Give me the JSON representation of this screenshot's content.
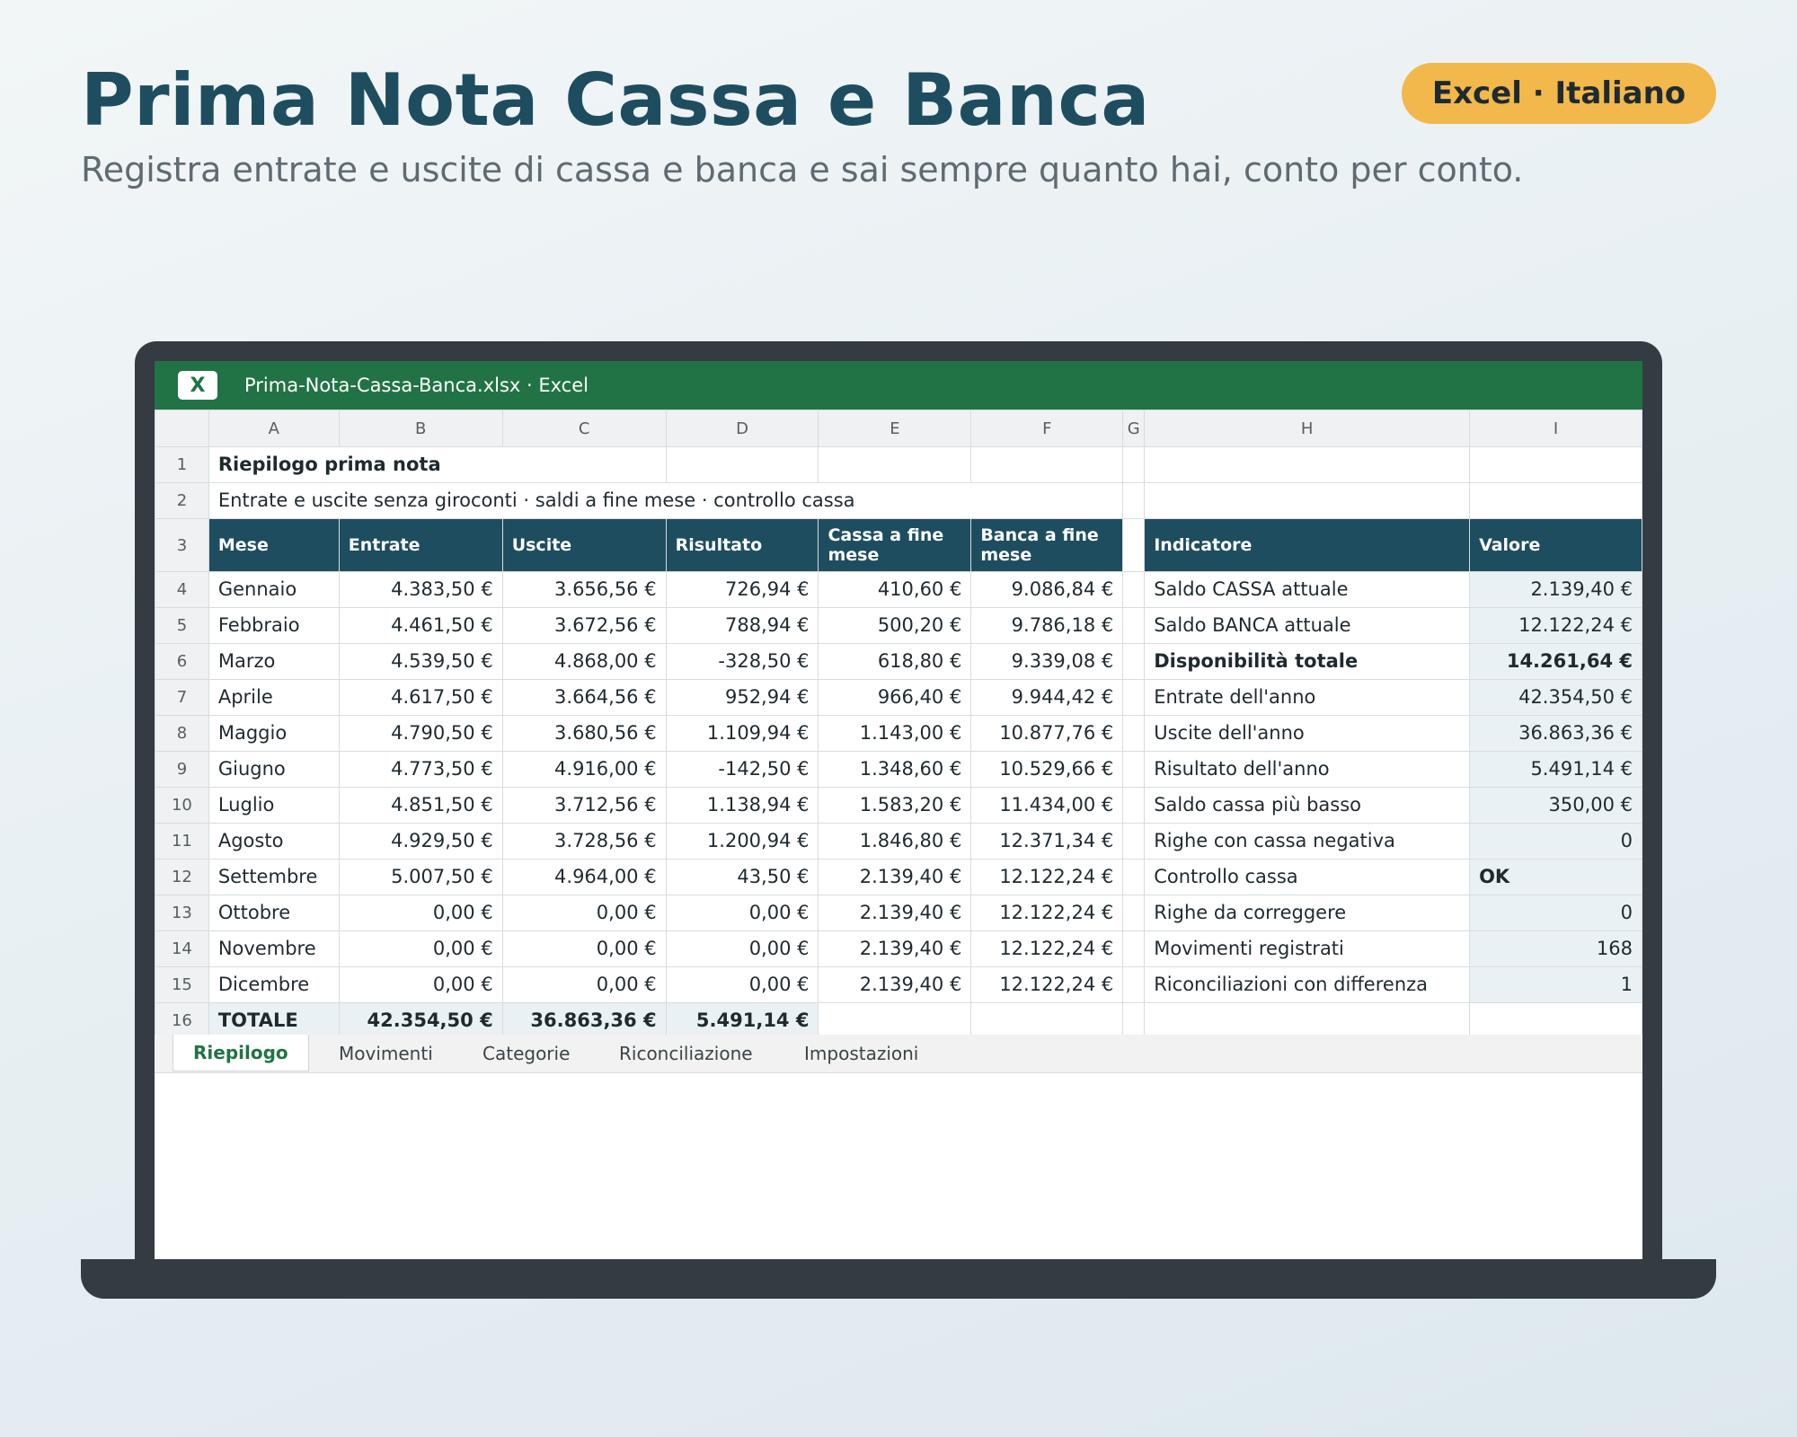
{
  "page": {
    "title": "Prima Nota Cassa e Banca",
    "subtitle": "Registra entrate e uscite di cassa e banca e sai sempre quanto hai, conto per conto.",
    "badge": "Excel · Italiano"
  },
  "window": {
    "app_icon": "X",
    "file_title": "Prima-Nota-Cassa-Banca.xlsx · Excel"
  },
  "sheet": {
    "columns": [
      "A",
      "B",
      "C",
      "D",
      "E",
      "F",
      "G",
      "H",
      "I"
    ],
    "title": "Riepilogo prima nota",
    "subtitle": "Entrate e uscite senza giroconti · saldi a fine mese · controllo cassa",
    "headers": [
      "Mese",
      "Entrate",
      "Uscite",
      "Risultato",
      "Cassa a fine mese",
      "Banca a fine mese"
    ],
    "kpi_headers": [
      "Indicatore",
      "Valore"
    ],
    "months": [
      {
        "row": "4",
        "mese": "Gennaio",
        "entrate": "4.383,50 €",
        "uscite": "3.656,56 €",
        "risultato": "726,94 €",
        "cassa": "410,60 €",
        "banca": "9.086,84 €"
      },
      {
        "row": "5",
        "mese": "Febbraio",
        "entrate": "4.461,50 €",
        "uscite": "3.672,56 €",
        "risultato": "788,94 €",
        "cassa": "500,20 €",
        "banca": "9.786,18 €"
      },
      {
        "row": "6",
        "mese": "Marzo",
        "entrate": "4.539,50 €",
        "uscite": "4.868,00 €",
        "risultato": "-328,50 €",
        "cassa": "618,80 €",
        "banca": "9.339,08 €"
      },
      {
        "row": "7",
        "mese": "Aprile",
        "entrate": "4.617,50 €",
        "uscite": "3.664,56 €",
        "risultato": "952,94 €",
        "cassa": "966,40 €",
        "banca": "9.944,42 €"
      },
      {
        "row": "8",
        "mese": "Maggio",
        "entrate": "4.790,50 €",
        "uscite": "3.680,56 €",
        "risultato": "1.109,94 €",
        "cassa": "1.143,00 €",
        "banca": "10.877,76 €"
      },
      {
        "row": "9",
        "mese": "Giugno",
        "entrate": "4.773,50 €",
        "uscite": "4.916,00 €",
        "risultato": "-142,50 €",
        "cassa": "1.348,60 €",
        "banca": "10.529,66 €"
      },
      {
        "row": "10",
        "mese": "Luglio",
        "entrate": "4.851,50 €",
        "uscite": "3.712,56 €",
        "risultato": "1.138,94 €",
        "cassa": "1.583,20 €",
        "banca": "11.434,00 €"
      },
      {
        "row": "11",
        "mese": "Agosto",
        "entrate": "4.929,50 €",
        "uscite": "3.728,56 €",
        "risultato": "1.200,94 €",
        "cassa": "1.846,80 €",
        "banca": "12.371,34 €"
      },
      {
        "row": "12",
        "mese": "Settembre",
        "entrate": "5.007,50 €",
        "uscite": "4.964,00 €",
        "risultato": "43,50 €",
        "cassa": "2.139,40 €",
        "banca": "12.122,24 €"
      },
      {
        "row": "13",
        "mese": "Ottobre",
        "entrate": "0,00 €",
        "uscite": "0,00 €",
        "risultato": "0,00 €",
        "cassa": "2.139,40 €",
        "banca": "12.122,24 €"
      },
      {
        "row": "14",
        "mese": "Novembre",
        "entrate": "0,00 €",
        "uscite": "0,00 €",
        "risultato": "0,00 €",
        "cassa": "2.139,40 €",
        "banca": "12.122,24 €"
      },
      {
        "row": "15",
        "mese": "Dicembre",
        "entrate": "0,00 €",
        "uscite": "0,00 €",
        "risultato": "0,00 €",
        "cassa": "2.139,40 €",
        "banca": "12.122,24 €"
      }
    ],
    "kpis": [
      {
        "label": "Saldo CASSA attuale",
        "value": "2.139,40 €"
      },
      {
        "label": "Saldo BANCA attuale",
        "value": "12.122,24 €"
      },
      {
        "label": "Disponibilità totale",
        "value": "14.261,64 €",
        "emphasis": true
      },
      {
        "label": "Entrate dell'anno",
        "value": "42.354,50 €"
      },
      {
        "label": "Uscite dell'anno",
        "value": "36.863,36 €"
      },
      {
        "label": "Risultato dell'anno",
        "value": "5.491,14 €"
      },
      {
        "label": "Saldo cassa più basso",
        "value": "350,00 €"
      },
      {
        "label": "Righe con cassa negativa",
        "value": "0"
      },
      {
        "label": "Controllo cassa",
        "value": "OK",
        "status": true
      },
      {
        "label": "Righe da correggere",
        "value": "0"
      },
      {
        "label": "Movimenti registrati",
        "value": "168"
      },
      {
        "label": "Riconciliazioni con differenza",
        "value": "1"
      }
    ],
    "total": {
      "label": "TOTALE",
      "entrate": "42.354,50 €",
      "uscite": "36.863,36 €",
      "risultato": "5.491,14 €"
    }
  },
  "tabs": [
    "Riepilogo",
    "Movimenti",
    "Categorie",
    "Riconciliazione",
    "Impostazioni"
  ],
  "active_tab": "Riepilogo",
  "colors": {
    "header": "#1e4d60",
    "excel_green": "#217346",
    "badge": "#f2b84b",
    "ok": "#2e8b57"
  }
}
